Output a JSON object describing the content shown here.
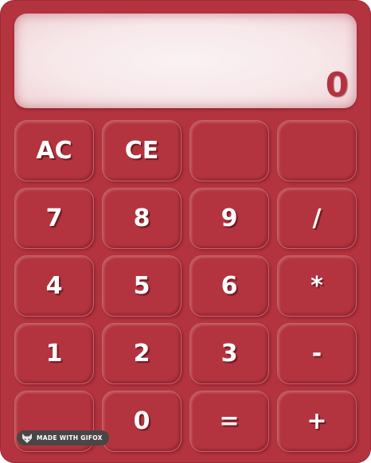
{
  "display": {
    "value": "0"
  },
  "keys": [
    {
      "name": "clear-all-button",
      "label": "AC"
    },
    {
      "name": "clear-entry-button",
      "label": "CE"
    },
    {
      "name": "blank-button-1",
      "label": ""
    },
    {
      "name": "blank-button-2",
      "label": ""
    },
    {
      "name": "digit-7-button",
      "label": "7"
    },
    {
      "name": "digit-8-button",
      "label": "8"
    },
    {
      "name": "digit-9-button",
      "label": "9"
    },
    {
      "name": "divide-button",
      "label": "/"
    },
    {
      "name": "digit-4-button",
      "label": "4"
    },
    {
      "name": "digit-5-button",
      "label": "5"
    },
    {
      "name": "digit-6-button",
      "label": "6"
    },
    {
      "name": "multiply-button",
      "label": "*"
    },
    {
      "name": "digit-1-button",
      "label": "1"
    },
    {
      "name": "digit-2-button",
      "label": "2"
    },
    {
      "name": "digit-3-button",
      "label": "3"
    },
    {
      "name": "subtract-button",
      "label": "-"
    },
    {
      "name": "decimal-button",
      "label": "."
    },
    {
      "name": "digit-0-button",
      "label": "0"
    },
    {
      "name": "equals-button",
      "label": "="
    },
    {
      "name": "add-button",
      "label": "+"
    }
  ],
  "badge": {
    "label": "MADE WITH GIFOX",
    "icon": "fox-icon"
  },
  "colors": {
    "body": "#b3343f",
    "display_background": "#f7e8ea",
    "display_text": "#b3343f",
    "key_text": "#ffffff",
    "badge_background": "#4a4646"
  }
}
